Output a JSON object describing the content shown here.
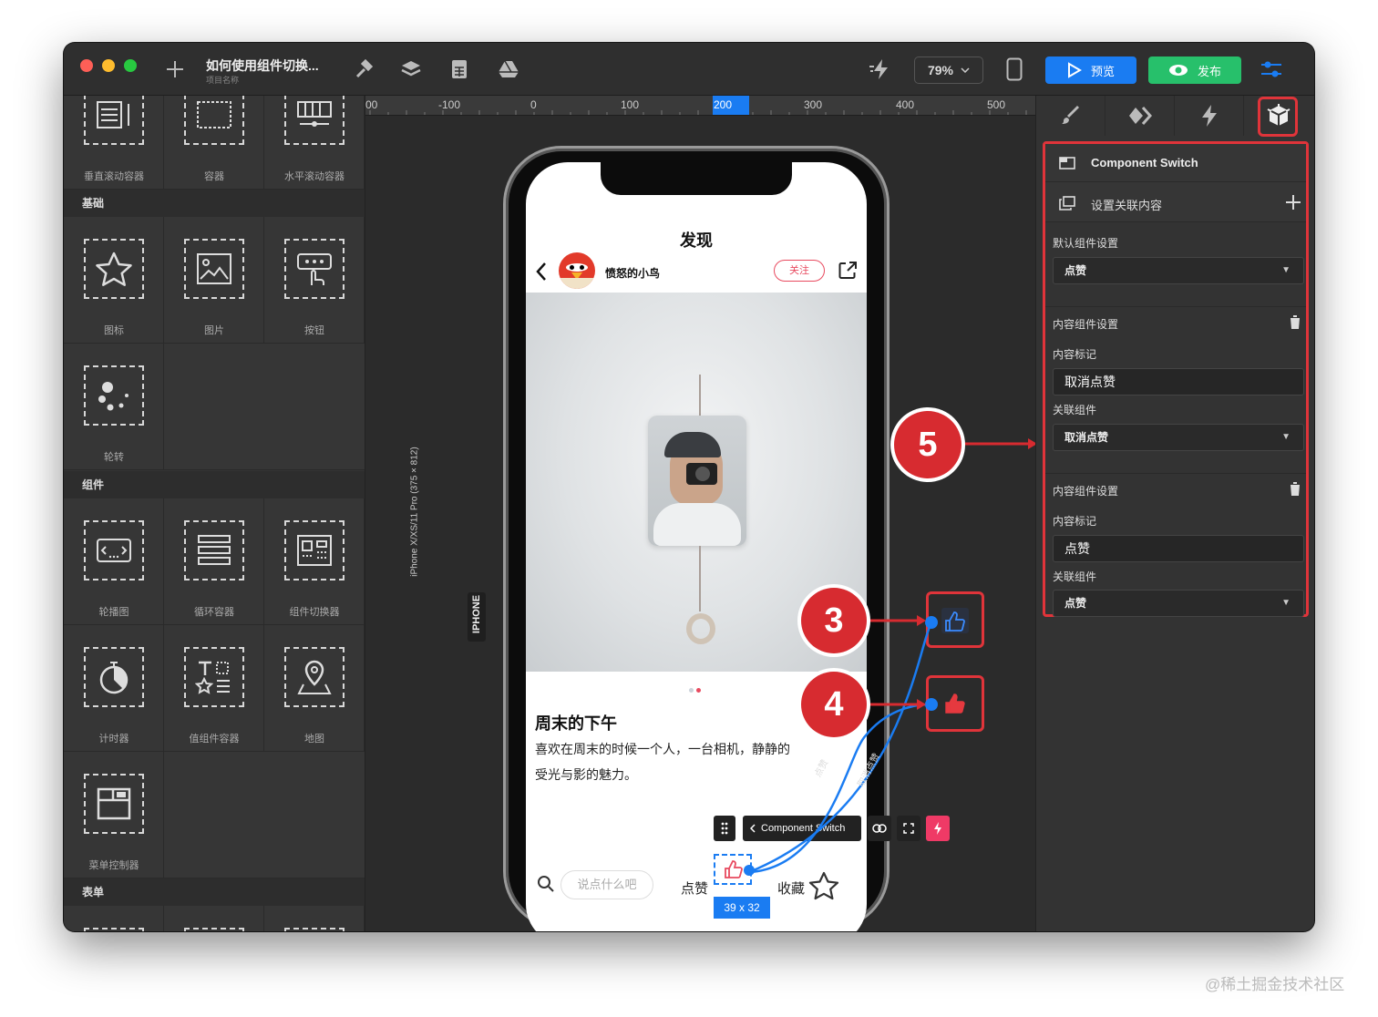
{
  "window": {
    "project_title": "如何使用组件切换...",
    "project_subtitle": "项目名称",
    "zoom": "79%",
    "preview_label": "预览",
    "publish_label": "发布"
  },
  "left_panel": {
    "top_items": [
      "垂直滚动容器",
      "容器",
      "水平滚动容器"
    ],
    "section_basic": "基础",
    "basic_items": [
      "图标",
      "图片",
      "按钮",
      "轮转"
    ],
    "section_components": "组件",
    "component_items": [
      "轮播图",
      "循环容器",
      "组件切换器",
      "计时器",
      "值组件容器",
      "地图",
      "菜单控制器"
    ],
    "section_form": "表单"
  },
  "ruler": {
    "ticks": [
      "00",
      "-100",
      "0",
      "100",
      "200",
      "300",
      "400",
      "500"
    ]
  },
  "device_label": {
    "tag": "IPHONE",
    "model": "iPhone X/XS/11 Pro (375 × 812)"
  },
  "phone": {
    "header_title": "发现",
    "username": "愤怒的小鸟",
    "follow_label": "关注",
    "post_title": "周末的下午",
    "post_body_1": "喜欢在周末的时候一个人，一台相机，静静的",
    "post_body_2": "受光与影的魅力。",
    "comment_placeholder": "说点什么吧",
    "like_label": "点赞",
    "collect_label": "收藏",
    "selection_size": "39 x 32"
  },
  "canvas_toolbar": {
    "component_label": "Component Switch"
  },
  "connectors": {
    "label_a": "点赞",
    "label_b": "取消点赞"
  },
  "callouts": [
    "3",
    "4",
    "5"
  ],
  "right_panel": {
    "panel_title": "Component Switch",
    "set_content_label": "设置关联内容",
    "default_setting_label": "默认组件设置",
    "default_value": "点赞",
    "content_setting_1": "内容组件设置",
    "content_tag_label_1": "内容标记",
    "content_tag_value_1": "取消点赞",
    "link_component_label_1": "关联组件",
    "link_component_value_1": "取消点赞",
    "content_setting_2": "内容组件设置",
    "content_tag_label_2": "内容标记",
    "content_tag_value_2": "点赞",
    "link_component_label_2": "关联组件",
    "link_component_value_2": "点赞"
  },
  "watermark": "@稀土掘金技术社区",
  "colors": {
    "accent_blue": "#1a7cf2",
    "publish_green": "#27c06b",
    "callout_red": "#d72b30",
    "follow_red": "#e84a5f"
  }
}
